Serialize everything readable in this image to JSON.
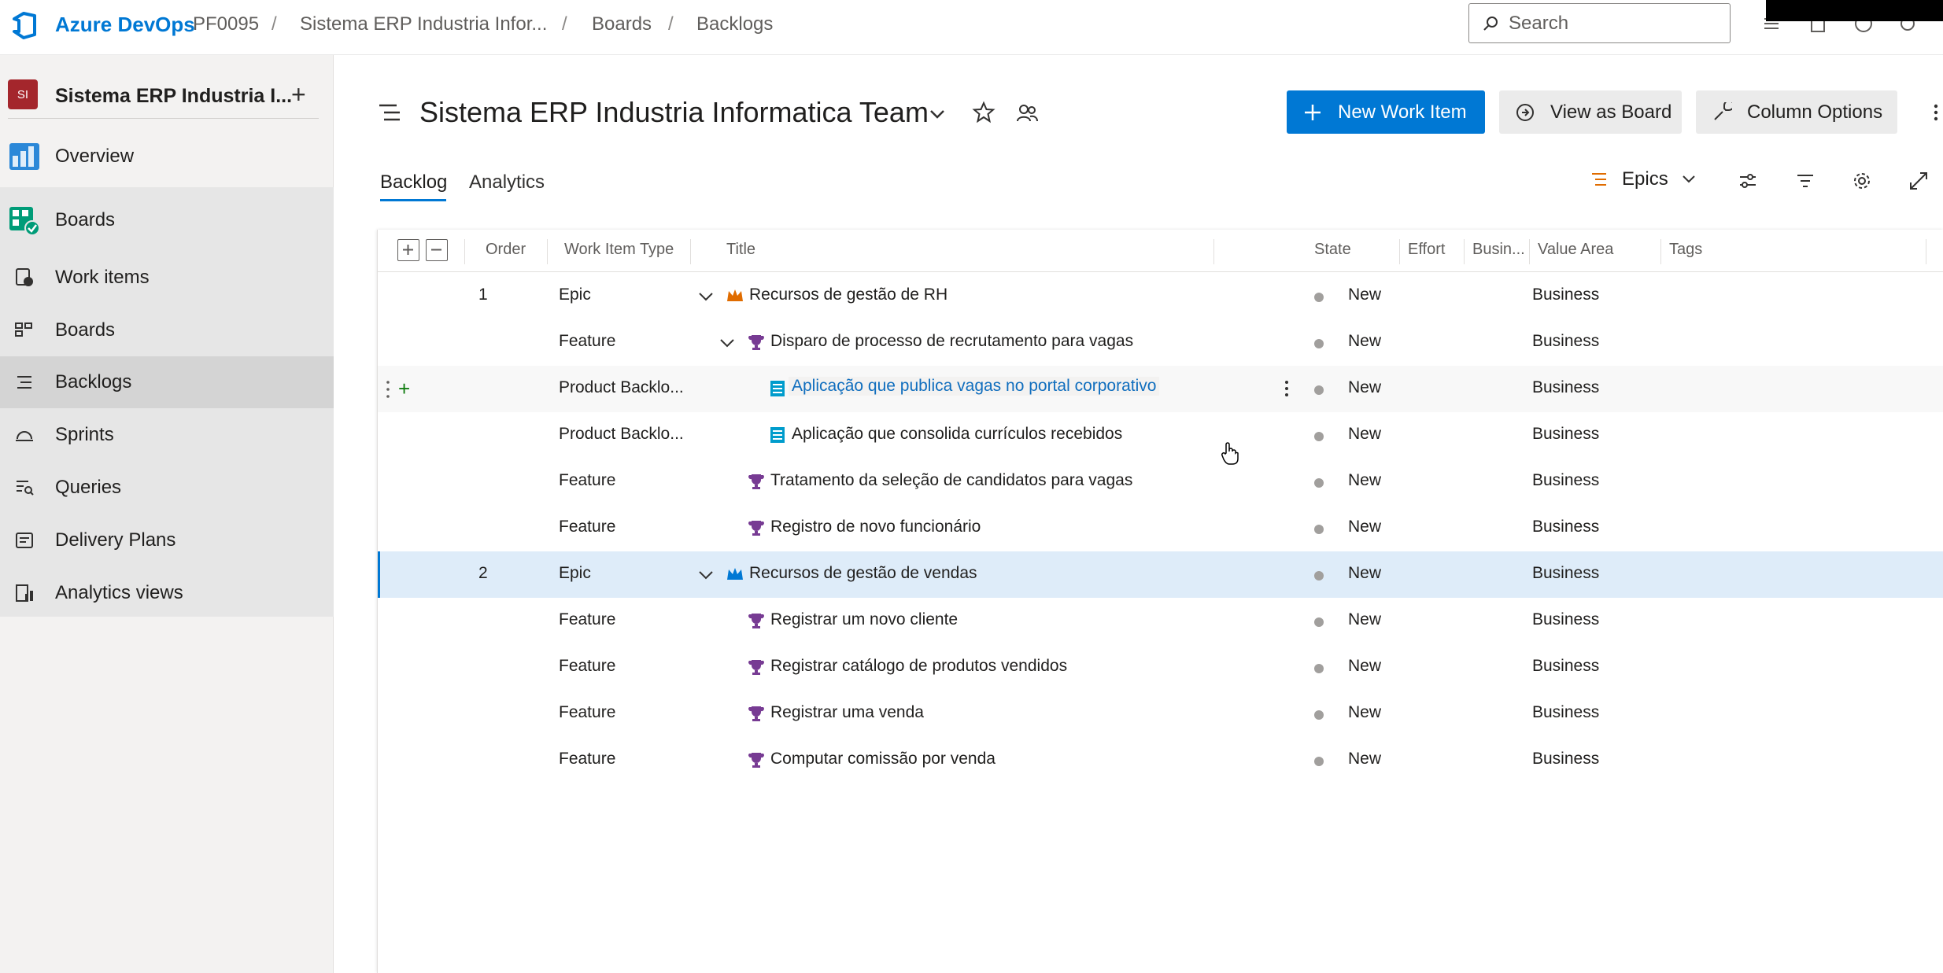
{
  "topbar": {
    "brand": "Azure DevOps",
    "breadcrumbs": [
      "PF0095",
      "Sistema ERP Industria Infor...",
      "Boards",
      "Backlogs"
    ],
    "search_placeholder": "Search"
  },
  "sidebar": {
    "project_avatar": "SI",
    "project_name": "Sistema ERP Industria I...",
    "items": [
      {
        "label": "Overview",
        "icon": "overview-icon"
      },
      {
        "label": "Boards",
        "icon": "boards-hub-icon"
      },
      {
        "label": "Work items",
        "icon": "work-items-icon"
      },
      {
        "label": "Boards",
        "icon": "boards-icon"
      },
      {
        "label": "Backlogs",
        "icon": "backlogs-icon"
      },
      {
        "label": "Sprints",
        "icon": "sprints-icon"
      },
      {
        "label": "Queries",
        "icon": "queries-icon"
      },
      {
        "label": "Delivery Plans",
        "icon": "delivery-plans-icon"
      },
      {
        "label": "Analytics views",
        "icon": "analytics-views-icon"
      }
    ]
  },
  "header": {
    "team_title": "Sistema ERP Industria Informatica Team",
    "new_work_item": "New Work Item",
    "view_as_board": "View as Board",
    "column_options": "Column Options"
  },
  "tabs": {
    "backlog": "Backlog",
    "analytics": "Analytics"
  },
  "level_selector": "Epics",
  "columns": {
    "order": "Order",
    "work_item_type": "Work Item Type",
    "title": "Title",
    "state": "State",
    "effort": "Effort",
    "business": "Busin...",
    "value_area": "Value Area",
    "tags": "Tags"
  },
  "rows": [
    {
      "order": "1",
      "type": "Epic",
      "title": "Recursos de gestão de RH",
      "state": "New",
      "value_area": "Business"
    },
    {
      "order": "",
      "type": "Feature",
      "title": "Disparo de processo de recrutamento para vagas",
      "state": "New",
      "value_area": "Business"
    },
    {
      "order": "",
      "type": "Product Backlo...",
      "title": "Aplicação que publica vagas no portal corporativo",
      "state": "New",
      "value_area": "Business"
    },
    {
      "order": "",
      "type": "Product Backlo...",
      "title": "Aplicação que consolida currículos recebidos",
      "state": "New",
      "value_area": "Business"
    },
    {
      "order": "",
      "type": "Feature",
      "title": "Tratamento da seleção de candidatos para vagas",
      "state": "New",
      "value_area": "Business"
    },
    {
      "order": "",
      "type": "Feature",
      "title": "Registro de novo funcionário",
      "state": "New",
      "value_area": "Business"
    },
    {
      "order": "2",
      "type": "Epic",
      "title": "Recursos de gestão de vendas",
      "state": "New",
      "value_area": "Business"
    },
    {
      "order": "",
      "type": "Feature",
      "title": "Registrar um novo cliente",
      "state": "New",
      "value_area": "Business"
    },
    {
      "order": "",
      "type": "Feature",
      "title": "Registrar catálogo de produtos vendidos",
      "state": "New",
      "value_area": "Business"
    },
    {
      "order": "",
      "type": "Feature",
      "title": "Registrar uma venda",
      "state": "New",
      "value_area": "Business"
    },
    {
      "order": "",
      "type": "Feature",
      "title": "Computar comissão por venda",
      "state": "New",
      "value_area": "Business"
    }
  ],
  "colors": {
    "accent": "#0078d4",
    "epic": "#e06c00",
    "epic_selected": "#0078d4",
    "feature": "#773b93",
    "pbi": "#009ccc",
    "state_new": "#a19f9d"
  }
}
